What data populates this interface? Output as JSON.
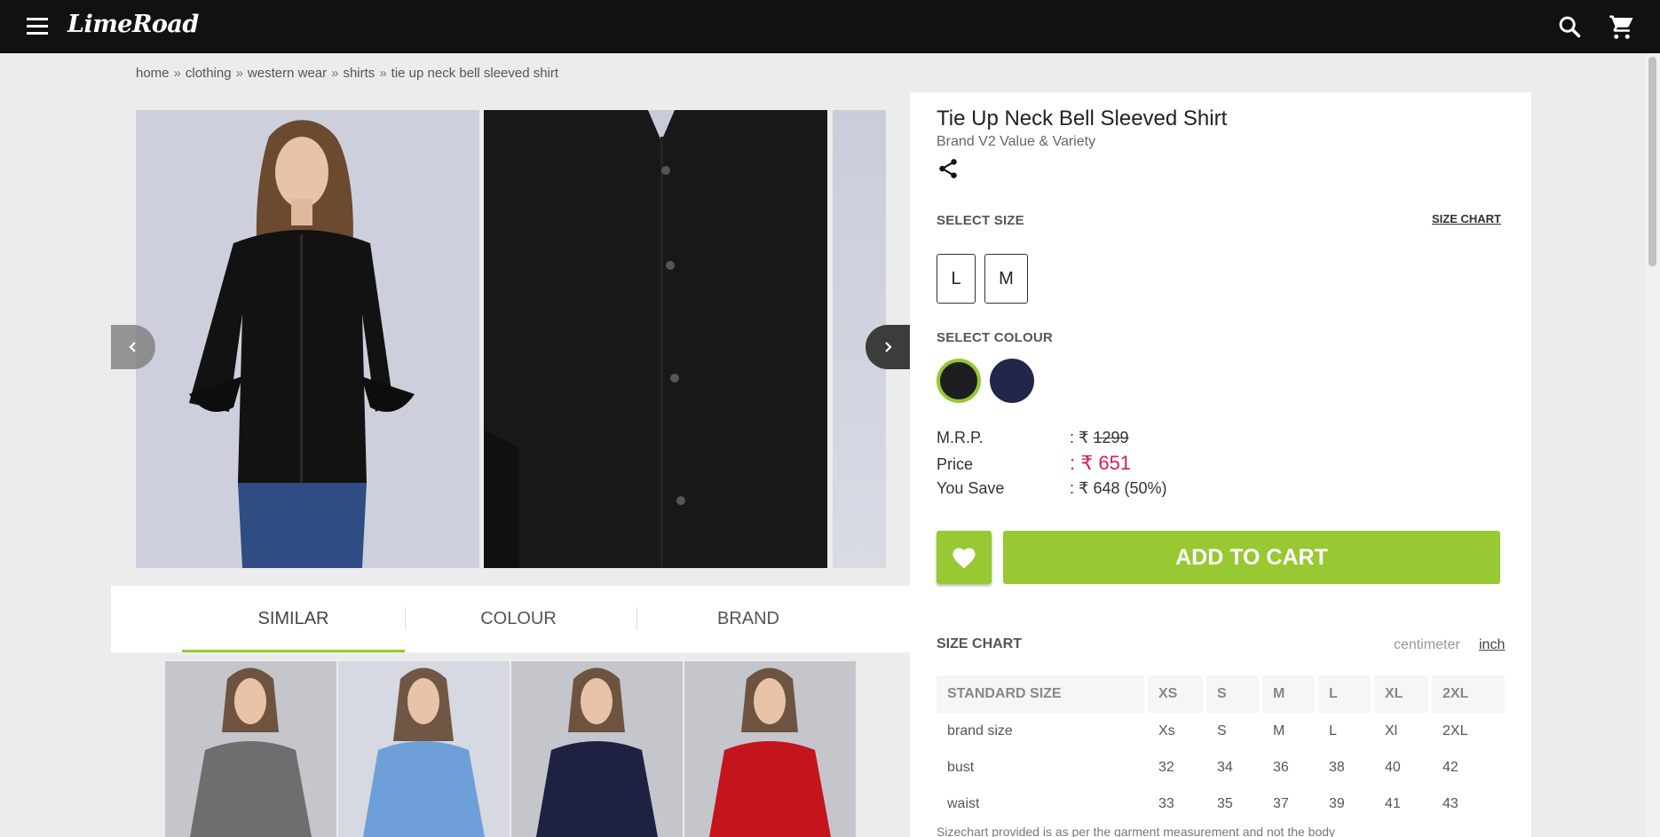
{
  "header": {
    "logo": "LimeRoad",
    "menu_icon": "menu-icon",
    "search_icon": "search-icon",
    "cart_icon": "cart-icon"
  },
  "breadcrumb": [
    "home",
    "clothing",
    "western wear",
    "shirts",
    "tie up neck bell sleeved shirt"
  ],
  "breadcrumb_separator": "»",
  "gallery": {
    "images": [
      "model-front-view",
      "shirt-fabric-closeup",
      "model-side-view"
    ],
    "prev_icon": "chevron-left-icon",
    "next_icon": "chevron-right-icon"
  },
  "tabs": [
    {
      "label": "SIMILAR",
      "active": true
    },
    {
      "label": "COLOUR",
      "active": false
    },
    {
      "label": "BRAND",
      "active": false
    }
  ],
  "similar_products": [
    {
      "color": "#6e6e6e"
    },
    {
      "color": "#6f9fd8"
    },
    {
      "color": "#1e2142"
    },
    {
      "color": "#c4151c"
    }
  ],
  "product": {
    "title": "Tie Up Neck Bell Sleeved Shirt",
    "brand": "Brand V2 Value & Variety",
    "share_icon": "share-icon"
  },
  "size_select": {
    "label": "SELECT SIZE",
    "size_chart_link": "SIZE CHART",
    "sizes": [
      "L",
      "M"
    ]
  },
  "colour_select": {
    "label": "SELECT COLOUR",
    "colours": [
      "#1e1e22",
      "#22264a"
    ],
    "selected_index": 0
  },
  "pricing": {
    "mrp_label": "M.R.P.",
    "mrp_prefix": ": ₹",
    "mrp_value": "1299",
    "price_label": "Price",
    "price_value": ": ₹ 651",
    "save_label": "You Save",
    "save_value": ": ₹ 648 (50%)"
  },
  "actions": {
    "wishlist_icon": "heart-icon",
    "add_to_cart": "ADD TO CART"
  },
  "size_chart": {
    "title": "SIZE CHART",
    "unit_cm": "centimeter",
    "unit_inch": "inch",
    "selected_unit": "inch",
    "headers": [
      "STANDARD SIZE",
      "XS",
      "S",
      "M",
      "L",
      "XL",
      "2XL"
    ],
    "rows": [
      [
        "brand size",
        "Xs",
        "S",
        "M",
        "L",
        "Xl",
        "2XL"
      ],
      [
        "bust",
        "32",
        "34",
        "36",
        "38",
        "40",
        "42"
      ],
      [
        "waist",
        "33",
        "35",
        "37",
        "39",
        "41",
        "43"
      ]
    ],
    "note": "Sizechart provided is as per the garment measurement and not the body"
  },
  "colors": {
    "accent": "#98c832",
    "price": "#d81b60",
    "topbar": "#111111"
  }
}
